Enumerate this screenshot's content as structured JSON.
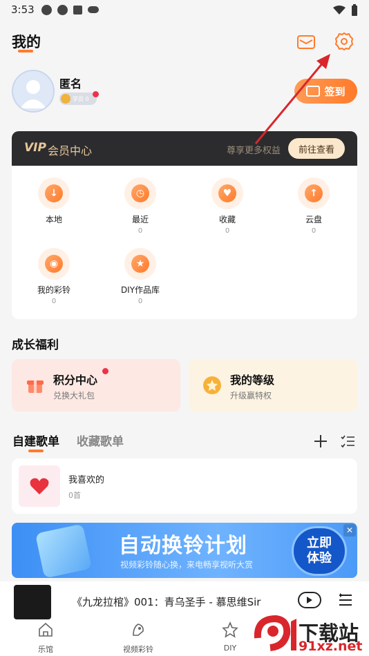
{
  "status_bar": {
    "time": "3:53"
  },
  "header": {
    "title": "我的"
  },
  "profile": {
    "name": "匿名",
    "level_label": "学员 0",
    "signin_label": "签到"
  },
  "vip": {
    "logo": "VIP",
    "title": "会员中心",
    "subtitle": "尊享更多权益",
    "button": "前往查看"
  },
  "grid": [
    {
      "label": "本地",
      "count": "",
      "glyph": "↓"
    },
    {
      "label": "最近",
      "count": "0",
      "glyph": "◷"
    },
    {
      "label": "收藏",
      "count": "0",
      "glyph": "♥"
    },
    {
      "label": "云盘",
      "count": "0",
      "glyph": "↑"
    },
    {
      "label": "我的彩铃",
      "count": "0",
      "glyph": "◉"
    },
    {
      "label": "DIY作品库",
      "count": "0",
      "glyph": "★"
    }
  ],
  "welfare": {
    "title": "成长福利",
    "points": {
      "title": "积分中心",
      "sub": "兑换大礼包"
    },
    "level": {
      "title": "我的等级",
      "sub": "升级赢特权"
    }
  },
  "playlists": {
    "tabs": [
      "自建歌单",
      "收藏歌单"
    ],
    "items": [
      {
        "name": "我喜欢的",
        "count": "0首"
      }
    ]
  },
  "banner": {
    "title": "自动换铃计划",
    "sub": "视频彩铃随心换，来电畅享视听大赏",
    "cta_line1": "立即",
    "cta_line2": "体验",
    "close": "✕"
  },
  "player": {
    "title": "《九龙拉棺》001：青乌圣手 - 慕思维Sir"
  },
  "bottom_nav": [
    {
      "label": "乐馆"
    },
    {
      "label": "视频彩铃"
    },
    {
      "label": "DIY"
    }
  ],
  "watermark": {
    "text": "下载站",
    "url": "91xz.net"
  },
  "colors": {
    "accent": "#ff7a2a",
    "vip_gold": "#e8c79a",
    "banner_blue": "#3d8ff5",
    "arrow_red": "#d9262c"
  }
}
